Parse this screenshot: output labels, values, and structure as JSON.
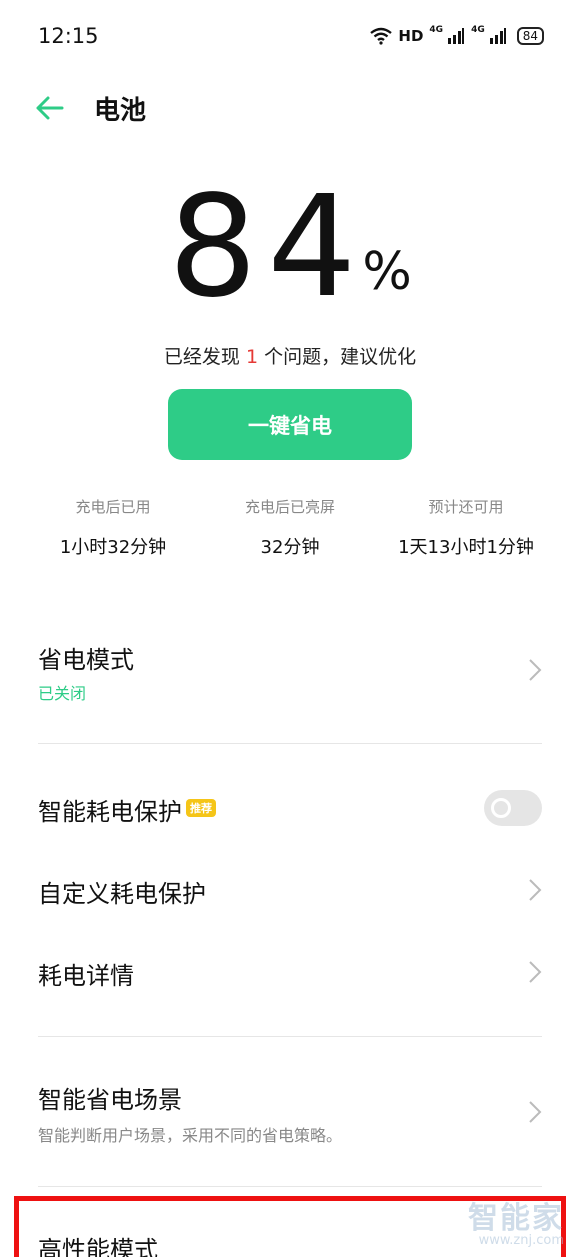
{
  "status_bar": {
    "time": "12:15",
    "hd_label": "HD",
    "network1": "4G",
    "network2": "4G",
    "battery": "84"
  },
  "header": {
    "title": "电池",
    "back_icon": "arrow-left-icon"
  },
  "battery": {
    "percent": "84",
    "percent_sign": "%",
    "issue_prefix": "已经发现 ",
    "issue_count": "1",
    "issue_suffix": " 个问题，建议优化",
    "optimize_button": "一键省电"
  },
  "stats": [
    {
      "label": "充电后已用",
      "value": "1小时32分钟"
    },
    {
      "label": "充电后已亮屏",
      "value": "32分钟"
    },
    {
      "label": "预计还可用",
      "value": "1天13小时1分钟"
    }
  ],
  "settings": {
    "power_saving": {
      "title": "省电模式",
      "status": "已关闭"
    },
    "smart_protection": {
      "title": "智能耗电保护",
      "badge": "推荐",
      "enabled": false
    },
    "custom_protection": {
      "title": "自定义耗电保护"
    },
    "consumption_details": {
      "title": "耗电详情"
    },
    "smart_scene": {
      "title": "智能省电场景",
      "subtitle": "智能判断用户场景，采用不同的省电策略。"
    },
    "high_performance": {
      "title": "高性能模式"
    }
  },
  "watermark": {
    "main": "智能家",
    "sub": "www.znj.com"
  },
  "colors": {
    "accent": "#2ecc87",
    "status_green": "#2ecc87",
    "issue_red": "#e53935",
    "badge_yellow": "#f5c518",
    "highlight_red": "#ee1111"
  }
}
